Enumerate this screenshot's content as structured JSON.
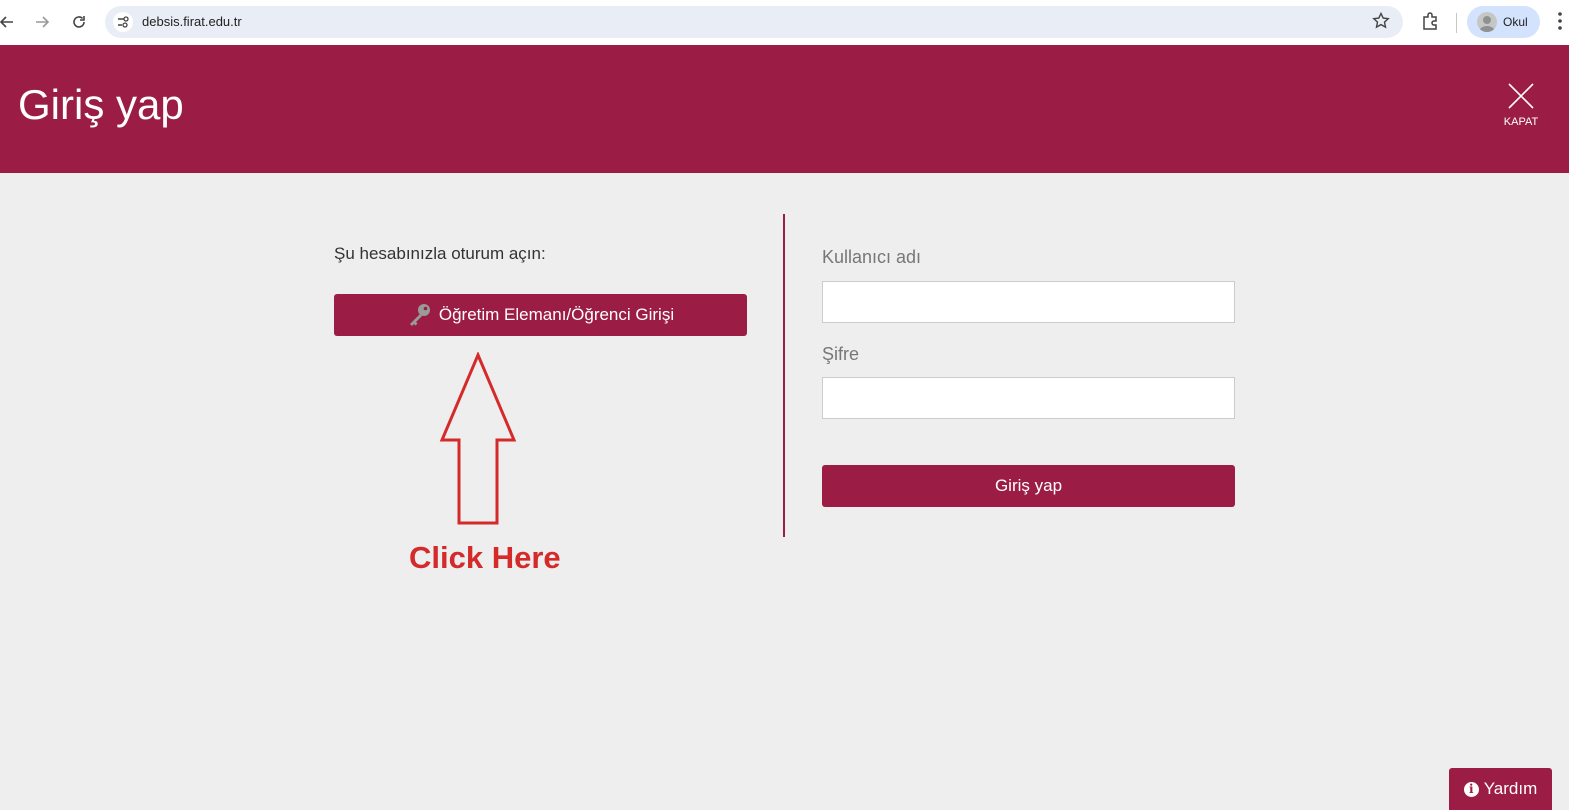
{
  "browser": {
    "url": "debsis.firat.edu.tr",
    "profile_name": "Okul"
  },
  "header": {
    "title": "Giriş yap",
    "close_label": "KAPAT"
  },
  "left_panel": {
    "prompt": "Şu hesabınızla oturum açın:",
    "sso_button_label": "Öğretim Elemanı/Öğrenci Girişi",
    "sso_icon": "key-icon"
  },
  "right_panel": {
    "username_label": "Kullanıcı adı",
    "username_value": "",
    "password_label": "Şifre",
    "password_value": "",
    "submit_label": "Giriş yap"
  },
  "annotation": {
    "text": "Click Here",
    "color": "#d42a2a"
  },
  "help": {
    "label": "Yardım",
    "icon": "info-icon"
  },
  "colors": {
    "brand": "#9b1d46",
    "background": "#eeeeee"
  }
}
